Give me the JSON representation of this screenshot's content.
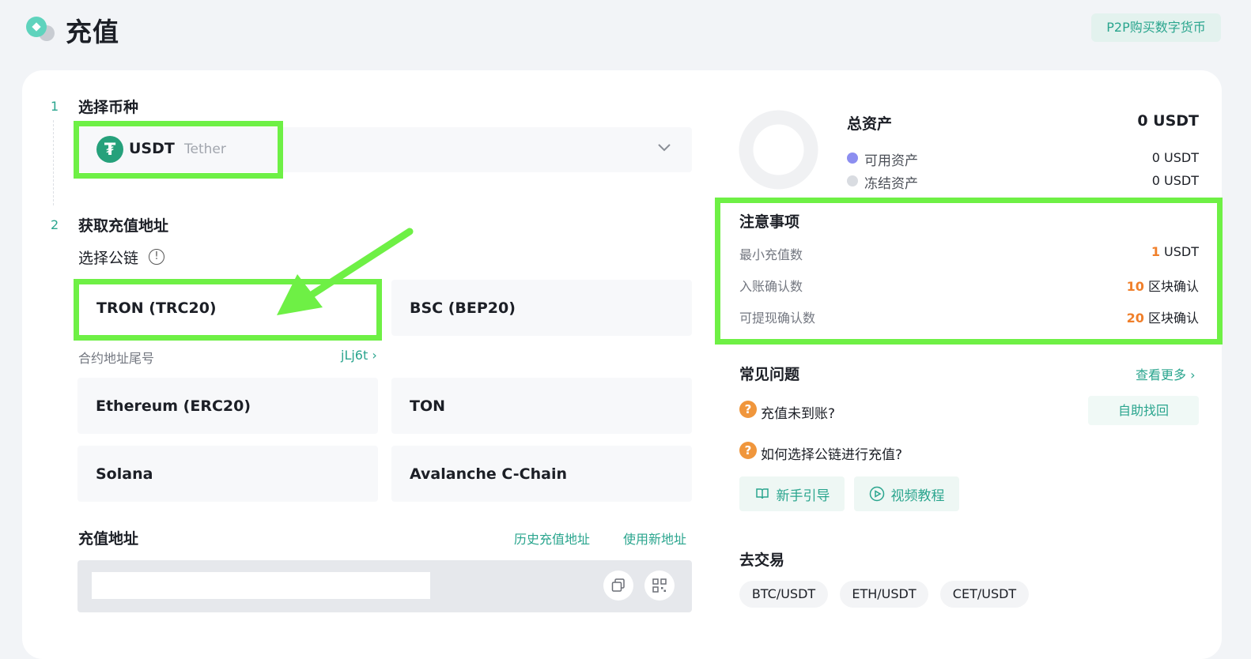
{
  "header": {
    "title": "充值",
    "p2p_button": "P2P购买数字货币",
    "logo_icon": "deposit-logo-icon"
  },
  "step1": {
    "number": "1",
    "title": "选择币种",
    "coin_symbol": "USDT",
    "coin_name": "Tether",
    "coin_icon_glyph": "₮"
  },
  "step2": {
    "number": "2",
    "title": "获取充值地址",
    "chain_label": "选择公链",
    "info_glyph": "!",
    "chains": [
      "TRON (TRC20)",
      "BSC (BEP20)",
      "Ethereum (ERC20)",
      "TON",
      "Solana",
      "Avalanche C-Chain"
    ],
    "selected_chain": "TRON (TRC20)",
    "contract_label": "合约地址尾号",
    "contract_suffix": "jLj6t ›"
  },
  "address": {
    "title": "充值地址",
    "history_link": "历史充值地址",
    "new_link": "使用新地址"
  },
  "assets": {
    "title": "总资产",
    "total": "0 USDT",
    "available_label": "可用资产",
    "available_value": "0 USDT",
    "frozen_label": "冻结资产",
    "frozen_value": "0 USDT",
    "available_color": "#8c8ef0",
    "frozen_color": "#d9dce1"
  },
  "notice": {
    "title": "注意事项",
    "rows": [
      {
        "label": "最小充值数",
        "num": "1",
        "unit": " USDT"
      },
      {
        "label": "入账确认数",
        "num": "10",
        "unit": " 区块确认"
      },
      {
        "label": "可提现确认数",
        "num": "20",
        "unit": " 区块确认"
      }
    ]
  },
  "faq": {
    "title": "常见问题",
    "more": "查看更多 ›",
    "q_glyph": "?",
    "q1": "充值未到账?",
    "self_help": "自助找回",
    "q2": "如何选择公链进行充值?",
    "guide": "新手引导",
    "video": "视频教程"
  },
  "trade": {
    "title": "去交易",
    "pairs": [
      "BTC/USDT",
      "ETH/USDT",
      "CET/USDT"
    ]
  },
  "colors": {
    "accent": "#2aa58e",
    "highlight": "#6ef045",
    "orange": "#f07f2a",
    "tether": "#26a17b"
  }
}
